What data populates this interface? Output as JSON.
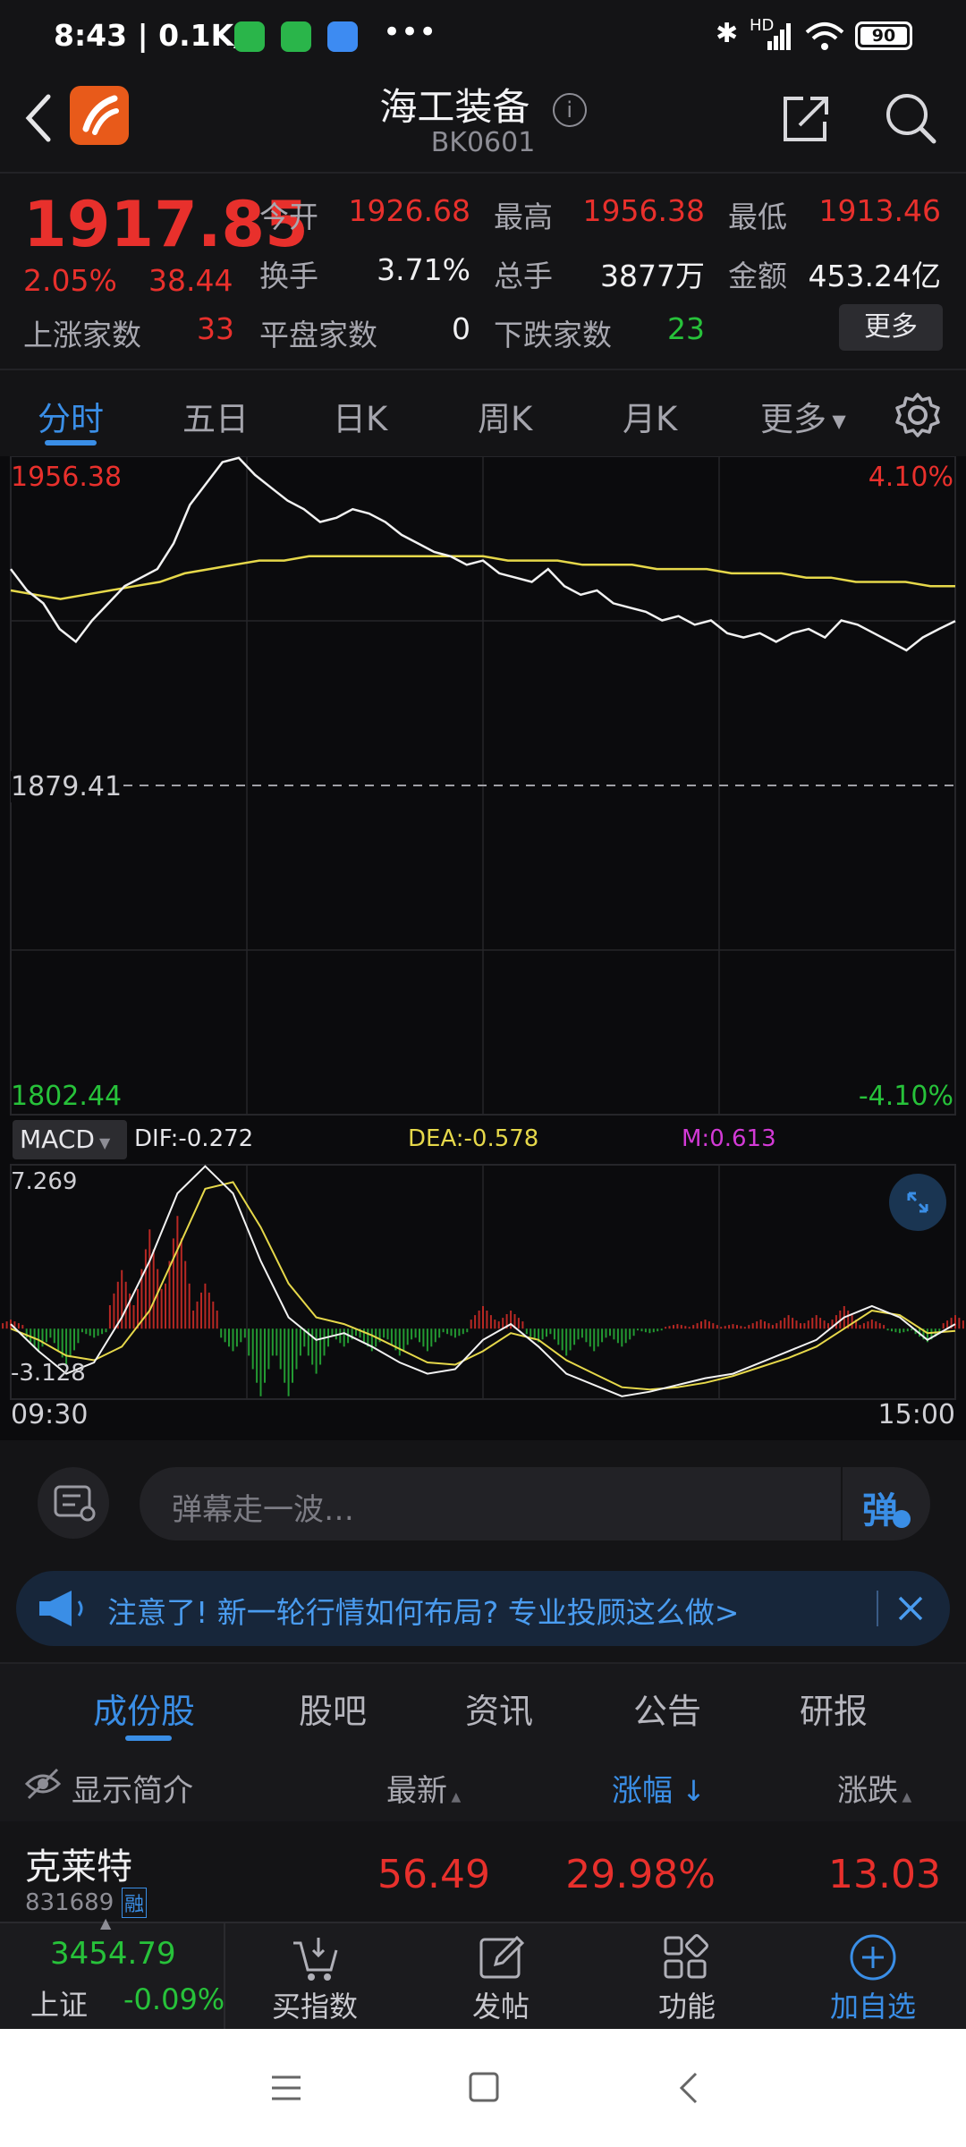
{
  "status_bar": {
    "time": "8:43",
    "speed": "0.1K/s",
    "battery": "90",
    "network": "HD"
  },
  "header": {
    "title": "海工装备",
    "code": "BK0601"
  },
  "quote": {
    "price": "1917.85",
    "change_pct": "2.05%",
    "change_abs": "38.44",
    "open_label": "今开",
    "open": "1926.68",
    "high_label": "最高",
    "high": "1956.38",
    "low_label": "最低",
    "low": "1913.46",
    "turnover_label": "换手",
    "turnover": "3.71%",
    "volume_label": "总手",
    "volume": "3877万",
    "amount_label": "金额",
    "amount": "453.24亿",
    "up_label": "上涨家数",
    "up_count": "33",
    "flat_label": "平盘家数",
    "flat_count": "0",
    "down_label": "下跌家数",
    "down_count": "23",
    "more_button": "更多"
  },
  "tabs": [
    "分时",
    "五日",
    "日K",
    "周K",
    "月K",
    "更多"
  ],
  "chart_data": {
    "type": "line",
    "y_high_label": "1956.38",
    "y_mid_label": "1879.41",
    "y_low_label": "1802.44",
    "pct_high_label": "4.10%",
    "pct_low_label": "-4.10%",
    "x_start": "09:30",
    "x_end": "15:00",
    "ylim": [
      1802.44,
      1956.38
    ],
    "prev_close": 1879.41,
    "series": [
      {
        "values": [
          1930,
          1925,
          1922,
          1916,
          1913,
          1918,
          1922,
          1926,
          1928,
          1930,
          1936,
          1945,
          1950,
          1955,
          1956,
          1952,
          1949,
          1946,
          1944,
          1941,
          1942,
          1944,
          1943,
          1941,
          1938,
          1936,
          1934,
          1933,
          1931,
          1932,
          1929,
          1928,
          1927,
          1930,
          1926,
          1924,
          1925,
          1922,
          1921,
          1920,
          1918,
          1919,
          1917,
          1918,
          1915,
          1914,
          1915,
          1913,
          1915,
          1916,
          1914,
          1918,
          1917,
          1915,
          1913,
          1911,
          1914,
          1916,
          1917.85
        ]
      },
      {
        "values": [
          1925,
          1924,
          1923,
          1924,
          1925,
          1926,
          1927,
          1929,
          1930,
          1931,
          1932,
          1932,
          1933,
          1933,
          1933,
          1933,
          1933,
          1933,
          1933,
          1933,
          1932,
          1932,
          1932,
          1931,
          1931,
          1931,
          1930,
          1930,
          1930,
          1929,
          1929,
          1929,
          1928,
          1928,
          1927,
          1927,
          1927,
          1926,
          1926
        ]
      }
    ],
    "macd": {
      "indicator": "MACD",
      "dif_label": "DIF:-0.272",
      "dea_label": "DEA:-0.578",
      "m_label": "M:0.613",
      "y_top_label": "7.269",
      "y_bottom_label": "-3.128",
      "ylim": [
        -3.128,
        7.269
      ],
      "dif": [
        0.2,
        -1,
        -2,
        -1.5,
        0.5,
        3,
        6,
        7.2,
        6,
        3,
        0.5,
        -0.5,
        -0.2,
        -0.8,
        -1.5,
        -2,
        -1.8,
        -0.5,
        0.2,
        -0.8,
        -2,
        -2.5,
        -3,
        -2.8,
        -2.5,
        -2.2,
        -2,
        -1.5,
        -1,
        -0.5,
        0.5,
        1,
        0.5,
        -0.5,
        0.2
      ],
      "dea": [
        0,
        -0.5,
        -1.2,
        -1.4,
        -0.8,
        0.8,
        3.5,
        6.2,
        6.5,
        4.5,
        2,
        0.5,
        0.2,
        -0.3,
        -0.9,
        -1.5,
        -1.6,
        -1,
        -0.2,
        -0.5,
        -1.4,
        -2,
        -2.6,
        -2.7,
        -2.6,
        -2.4,
        -2.1,
        -1.7,
        -1.3,
        -0.8,
        0,
        0.8,
        0.6,
        -0.2,
        -0.1
      ],
      "bars": [
        0.4,
        -1,
        -1.6,
        -0.4,
        2.6,
        4.4,
        5,
        2,
        -1,
        -3,
        -3,
        -2,
        -0.8,
        -1,
        -1.2,
        -1,
        -0.4,
        1,
        0.8,
        -0.6,
        -1.2,
        -1,
        -0.8,
        -0.2,
        0.2,
        0.4,
        0.2,
        0.4,
        0.6,
        0.6,
        1,
        0.4,
        -0.2,
        -0.6,
        0.6
      ]
    }
  },
  "danmaku": {
    "placeholder": "弹幕走一波…",
    "button_label": "弹"
  },
  "notice": {
    "text": "注意了! 新一轮行情如何布局? 专业投顾这么做>"
  },
  "bottom_tabs": [
    "成份股",
    "股吧",
    "资讯",
    "公告",
    "研报"
  ],
  "table": {
    "show_intro": "显示简介",
    "col_latest": "最新",
    "col_change_pct": "涨幅",
    "col_change": "涨跌",
    "rows": [
      {
        "name": "克莱特",
        "code": "831689",
        "tag": "融",
        "latest": "56.49",
        "change_pct": "29.98%",
        "change": "13.03"
      }
    ]
  },
  "dock": {
    "index_value": "3454.79",
    "index_name": "上证",
    "index_change": "-0.09%",
    "items": [
      "买指数",
      "发帖",
      "功能",
      "加自选"
    ]
  }
}
